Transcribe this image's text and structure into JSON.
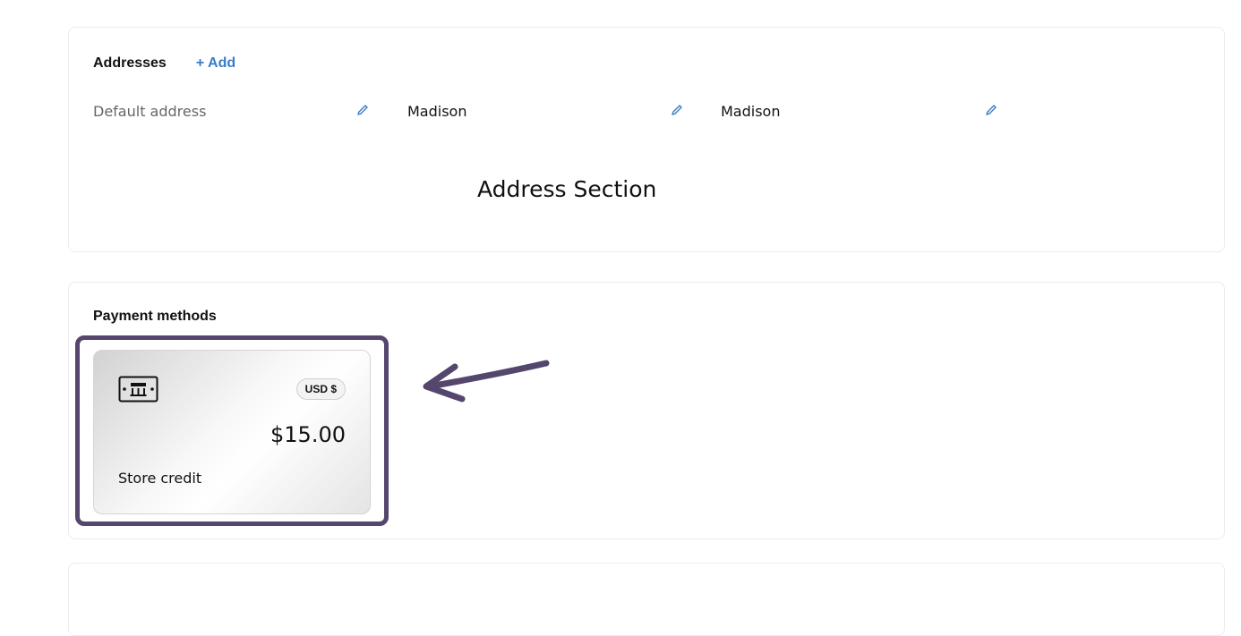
{
  "addresses": {
    "title": "Addresses",
    "add_label": "+ Add",
    "columns": [
      {
        "label": "Default address"
      },
      {
        "label": "Madison"
      },
      {
        "label": "Madison"
      }
    ],
    "section_caption": "Address Section"
  },
  "payments": {
    "title": "Payment methods",
    "card": {
      "currency": "USD $",
      "amount": "$15.00",
      "label": "Store credit",
      "icon": "store-icon"
    }
  },
  "colors": {
    "accent_link": "#3a7bc8",
    "highlight_border": "#54466d",
    "arrow": "#54466d"
  }
}
